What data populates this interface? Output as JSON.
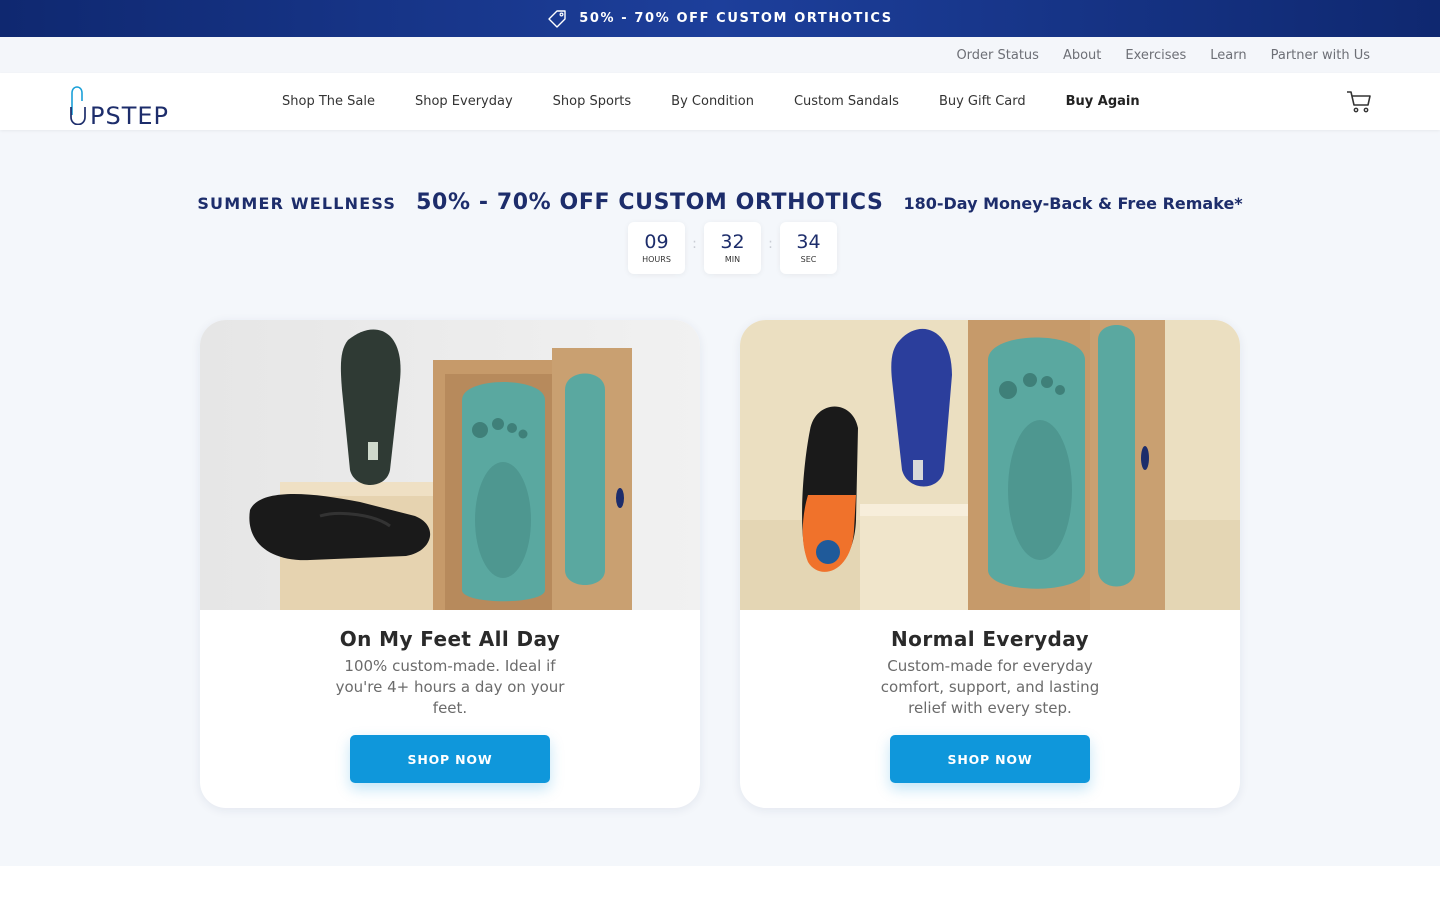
{
  "promo": {
    "text": "50% - 70% OFF CUSTOM ORTHOTICS",
    "icon": "tag-icon"
  },
  "utility_nav": [
    "Order Status",
    "About",
    "Exercises",
    "Learn",
    "Partner with Us"
  ],
  "header": {
    "logo_text": "UPSTEP",
    "nav": [
      "Shop The Sale",
      "Shop Everyday",
      "Shop Sports",
      "By Condition",
      "Custom Sandals",
      "Buy Gift Card",
      "Buy Again"
    ],
    "cart_icon": "cart-icon"
  },
  "hero": {
    "label": "SUMMER WELLNESS",
    "headline": "50% - 70% OFF CUSTOM ORTHOTICS",
    "guarantee": "180-Day Money-Back & Free Remake*"
  },
  "countdown": [
    {
      "value": "09",
      "label": "HOURS"
    },
    {
      "value": "32",
      "label": "MIN"
    },
    {
      "value": "34",
      "label": "SEC"
    }
  ],
  "cards": [
    {
      "title": "On My Feet All Day",
      "desc": "100% custom-made. Ideal if you're 4+ hours a day on your feet.",
      "button": "SHOP NOW"
    },
    {
      "title": "Normal Everyday",
      "desc": "Custom-made for everyday comfort, support, and lasting relief with every step.",
      "button": "SHOP NOW"
    }
  ],
  "colors": {
    "promo_bg": "#1d3f9b",
    "headline": "#1d2d6b",
    "button": "#0f97db"
  }
}
